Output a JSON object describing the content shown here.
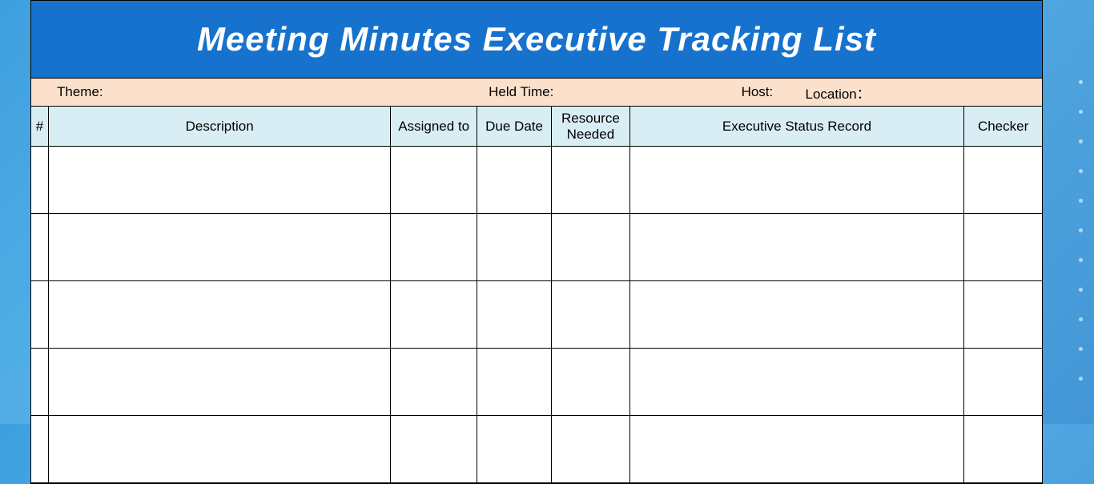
{
  "header": {
    "title": "Meeting Minutes Executive Tracking List"
  },
  "meta": {
    "theme_label": "Theme:",
    "held_time_label": "Held Time:",
    "host_label": "Host:",
    "location_label": "Location："
  },
  "columns": {
    "num": "#",
    "description": "Description",
    "assigned_to": "Assigned to",
    "due_date": "Due Date",
    "resource_needed": "Resource Needed",
    "executive_status": "Executive Status Record",
    "checker": "Checker"
  },
  "rows": [
    {
      "num": "",
      "description": "",
      "assigned_to": "",
      "due_date": "",
      "resource_needed": "",
      "executive_status": "",
      "checker": ""
    },
    {
      "num": "",
      "description": "",
      "assigned_to": "",
      "due_date": "",
      "resource_needed": "",
      "executive_status": "",
      "checker": ""
    },
    {
      "num": "",
      "description": "",
      "assigned_to": "",
      "due_date": "",
      "resource_needed": "",
      "executive_status": "",
      "checker": ""
    },
    {
      "num": "",
      "description": "",
      "assigned_to": "",
      "due_date": "",
      "resource_needed": "",
      "executive_status": "",
      "checker": ""
    },
    {
      "num": "",
      "description": "",
      "assigned_to": "",
      "due_date": "",
      "resource_needed": "",
      "executive_status": "",
      "checker": ""
    }
  ]
}
